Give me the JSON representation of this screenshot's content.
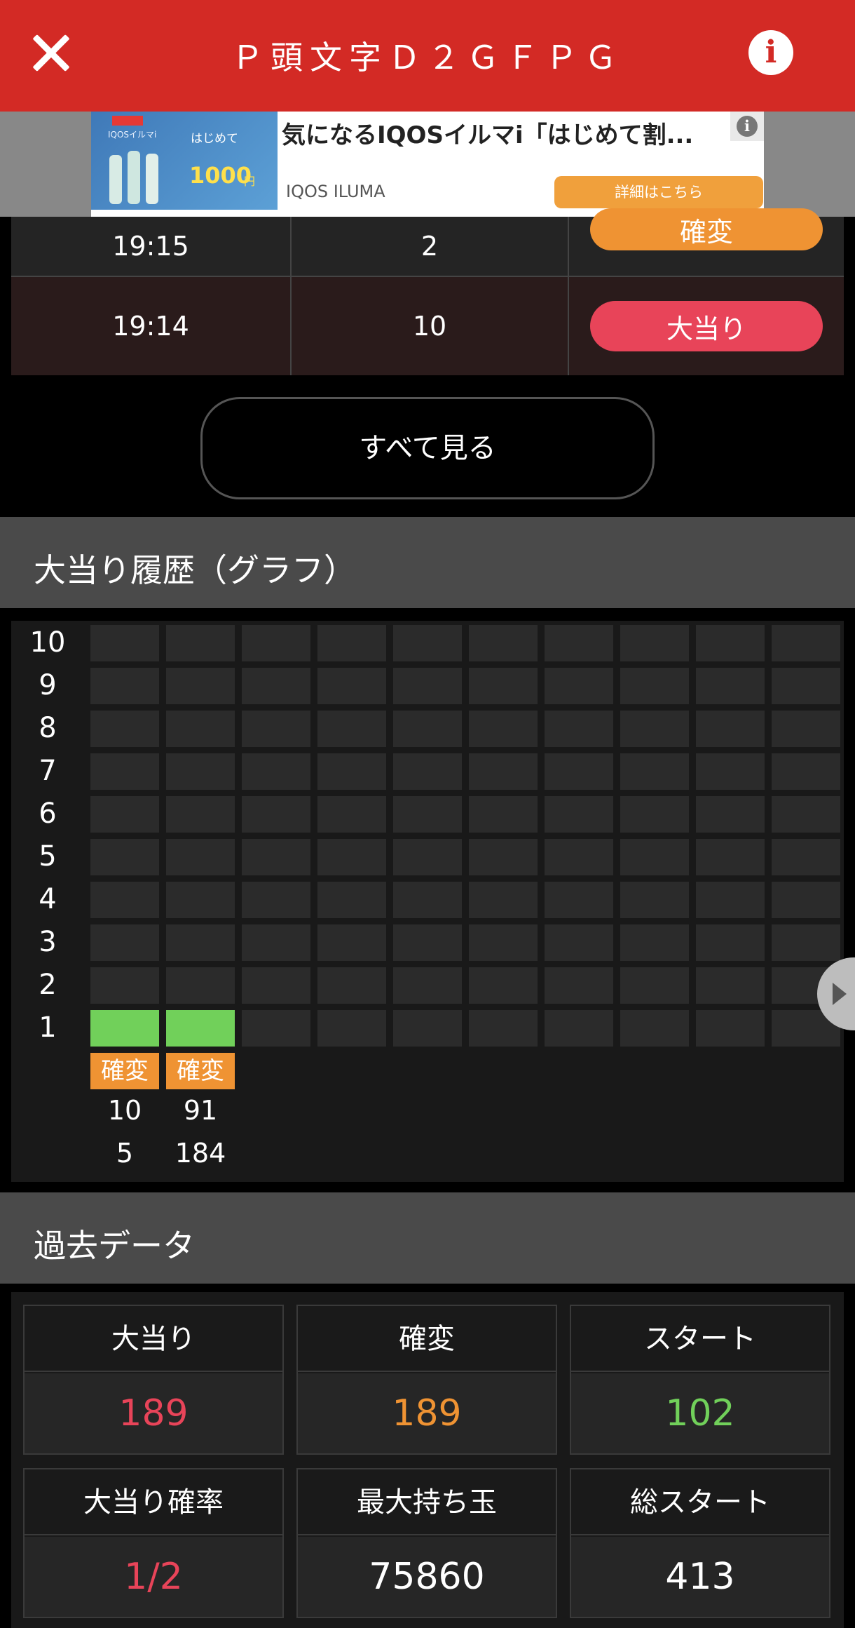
{
  "header": {
    "title": "Ｐ頭文字Ｄ２ＧＦＰＧ",
    "close_icon": "close-icon",
    "info_icon": "info-icon",
    "info_glyph": "i",
    "bg_color": "#d32a25"
  },
  "ad": {
    "image_brand": "IQOSイルマi",
    "image_badge": "はじめて",
    "image_price": "1000",
    "image_yen": "円",
    "headline": "気になるIQOSイルマi「はじめて割...",
    "advertiser": "IQOS ILUMA",
    "cta": "詳細はこちら",
    "info_glyph": "i"
  },
  "history_rows": [
    {
      "time": "19:15",
      "count": "2",
      "result": "確変"
    },
    {
      "time": "19:14",
      "count": "10",
      "result": "大当り"
    }
  ],
  "see_all_label": "すべて見る",
  "graph_section": {
    "title": "大当り履歴（グラフ）",
    "y_labels": [
      "10",
      "9",
      "8",
      "7",
      "6",
      "5",
      "4",
      "3",
      "2",
      "1"
    ],
    "columns": [
      {
        "tag": "確変",
        "line1": "10",
        "line2": "5"
      },
      {
        "tag": "確変",
        "line1": "91",
        "line2": "184"
      }
    ]
  },
  "past_section": {
    "title": "過去データ",
    "stats": [
      {
        "label": "大当り",
        "value": "189",
        "color": "#e84459"
      },
      {
        "label": "確変",
        "value": "189",
        "color": "#ef9333"
      },
      {
        "label": "スタート",
        "value": "102",
        "color": "#71d05a"
      },
      {
        "label": "大当り確率",
        "value": "1/2",
        "color": "#e84459"
      },
      {
        "label": "最大持ち玉",
        "value": "75860",
        "color": "#ffffff"
      },
      {
        "label": "総スタート",
        "value": "413",
        "color": "#ffffff"
      }
    ]
  }
}
